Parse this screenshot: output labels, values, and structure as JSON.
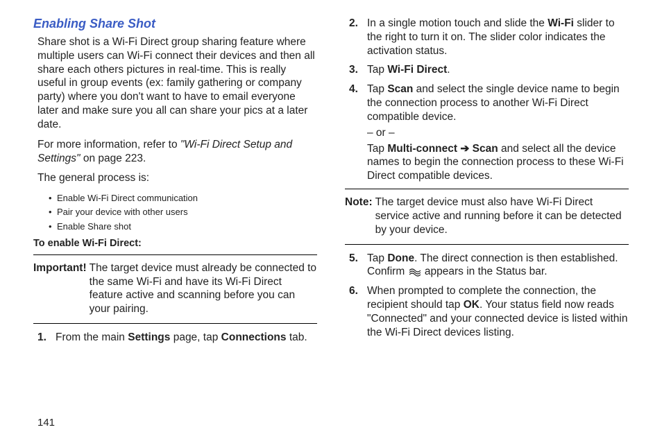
{
  "left": {
    "title": "Enabling Share Shot",
    "intro": "Share shot is a Wi-Fi Direct group sharing feature where multiple users can Wi-Fi connect their devices and then all share each others pictures in real-time. This is really useful in group events (ex: family gathering or company party) where you don't want to have to email everyone later and make sure you all can share your pics at a later date.",
    "moreinfo_pre": "For more information, refer to ",
    "moreinfo_ref": "\"Wi-Fi Direct Setup and Settings\"",
    "moreinfo_post": "  on page 223.",
    "process_intro": "The general process is:",
    "bullets": [
      "Enable Wi-Fi Direct communication",
      "Pair your device with other users",
      "Enable Share shot"
    ],
    "subheading": "To enable Wi-Fi Direct:",
    "important_label": "Important!",
    "important_text": " The target device must already be connected to the same Wi-Fi and have its Wi-Fi Direct feature active and scanning before you can your pairing.",
    "step1_num": "1.",
    "step1_pre": "From the main ",
    "step1_b1": "Settings",
    "step1_mid": " page, tap ",
    "step1_b2": "Connections",
    "step1_post": " tab."
  },
  "right": {
    "step2_num": "2.",
    "step2_pre": "In a single motion touch and slide the ",
    "step2_b": "Wi-Fi",
    "step2_post": " slider to the right to turn it on. The slider color indicates the activation status.",
    "step3_num": "3.",
    "step3_pre": "Tap ",
    "step3_b": "Wi-Fi Direct",
    "step3_post": ".",
    "step4_num": "4.",
    "step4_pre": "Tap ",
    "step4_b": "Scan",
    "step4_post": " and select the single device name to begin the connection process to another Wi-Fi Direct compatible device.",
    "or": "– or –",
    "step4b_pre": "Tap ",
    "step4b_b1": "Multi-connect",
    "step4b_arrow": " ➔ ",
    "step4b_b2": "Scan",
    "step4b_post": " and select all the device names to begin the connection process to these Wi-Fi Direct compatible devices.",
    "note_label": "Note:",
    "note_text": " The target device must also have Wi-Fi Direct service active and running before it can be detected by your device.",
    "step5_num": "5.",
    "step5_pre": "Tap ",
    "step5_b": "Done",
    "step5_mid": ". The direct connection is then established. Confirm ",
    "step5_post": " appears in the Status bar.",
    "step6_num": "6.",
    "step6_pre": "When prompted to complete the connection, the recipient should tap ",
    "step6_b": "OK",
    "step6_post": ". Your status field now reads \"Connected\" and your connected device is listed within the Wi-Fi Direct devices listing."
  },
  "page_number": "141"
}
